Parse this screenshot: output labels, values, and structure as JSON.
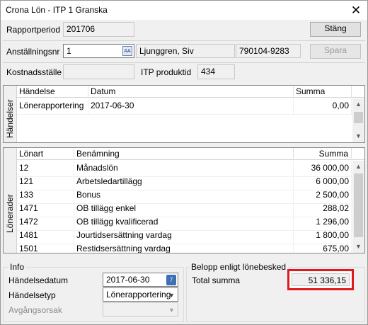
{
  "window": {
    "title": "Crona Lön - ITP 1 Granska",
    "close_glyph": "✕"
  },
  "header": {
    "rapportperiod_label": "Rapportperiod",
    "rapportperiod_value": "201706",
    "stang_label": "Stäng",
    "anstallningsnr_label": "Anställningsnr",
    "anstallningsnr_value": "1",
    "search_icon_glyph": "AA",
    "employee_name": "Ljunggren, Siv",
    "personnummer": "790104-9283",
    "spara_label": "Spara",
    "kostnadsstalle_label": "Kostnadsställe",
    "kostnadsstalle_value": "",
    "itp_produktid_label": "ITP produktid",
    "itp_produktid_value": "434"
  },
  "handelser": {
    "tab_label": "Händelser",
    "columns": [
      "Händelse",
      "Datum",
      "Summa"
    ],
    "rows": [
      {
        "handelse": "Lönerapportering",
        "datum": "2017-06-30",
        "summa": "0,00"
      }
    ]
  },
  "lonerader": {
    "tab_label": "Lönerader",
    "columns": [
      "Lönart",
      "Benämning",
      "Summa"
    ],
    "rows": [
      {
        "lonart": "12",
        "benamning": "Månadslön",
        "summa": "36 000,00"
      },
      {
        "lonart": "121",
        "benamning": "Arbetsledartillägg",
        "summa": "6 000,00"
      },
      {
        "lonart": "133",
        "benamning": "Bonus",
        "summa": "2 500,00"
      },
      {
        "lonart": "1471",
        "benamning": "OB tillägg enkel",
        "summa": "288,02"
      },
      {
        "lonart": "1472",
        "benamning": "OB tillägg kvalificerad",
        "summa": "1 296,00"
      },
      {
        "lonart": "1481",
        "benamning": "Jourtidsersättning vardag",
        "summa": "1 800,00"
      },
      {
        "lonart": "1501",
        "benamning": "Restidsersättning vardag",
        "summa": "675,00"
      }
    ]
  },
  "info": {
    "group_label": "Info",
    "handelsedatum_label": "Händelsedatum",
    "handelsedatum_value": "2017-06-30",
    "calendar_glyph": "7",
    "handelsetyp_label": "Händelsetyp",
    "handelsetyp_value": "Lönerapportering",
    "avgangsorsak_label": "Avgångsorsak",
    "avgangsorsak_value": ""
  },
  "belopp": {
    "group_label": "Belopp enligt lönebesked",
    "total_label": "Total summa",
    "total_value": "51 336,15",
    "highlight_color": "#e0191f"
  },
  "icons": {
    "scroll_up": "▲",
    "scroll_down": "▼",
    "dropdown": "▼"
  }
}
